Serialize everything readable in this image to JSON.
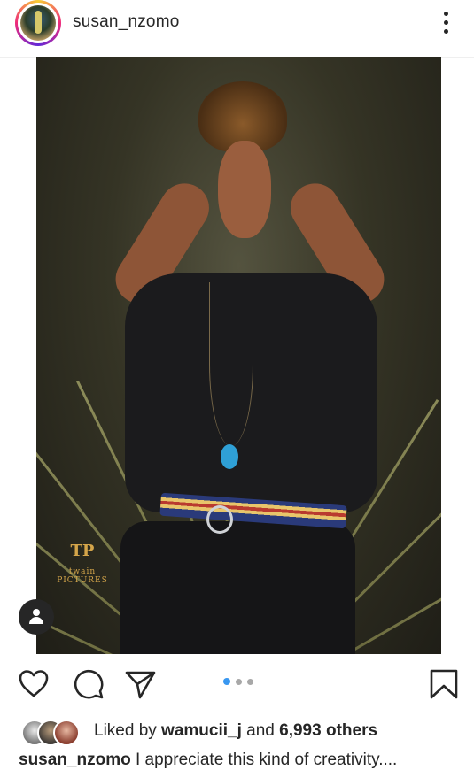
{
  "post": {
    "username": "susan_nzomo",
    "more_icon": "more-vertical-icon",
    "photo": {
      "watermark_logo": "TP",
      "watermark_text": "twain PICTURES",
      "carousel_total": 3,
      "carousel_active_index": 0
    },
    "actions": {
      "like_icon": "heart-icon",
      "comment_icon": "comment-icon",
      "share_icon": "send-icon",
      "save_icon": "bookmark-icon"
    },
    "likes": {
      "prefix": "Liked by ",
      "user": "wamucii_j",
      "conjunction": " and ",
      "others": "6,993 others"
    },
    "caption": {
      "username": "susan_nzomo",
      "text": " I appreciate this kind of creativity...."
    }
  },
  "colors": {
    "text": "#262626",
    "carousel_active": "#3897f0",
    "carousel_inactive": "#a8a8a8",
    "divider": "#efefef"
  }
}
